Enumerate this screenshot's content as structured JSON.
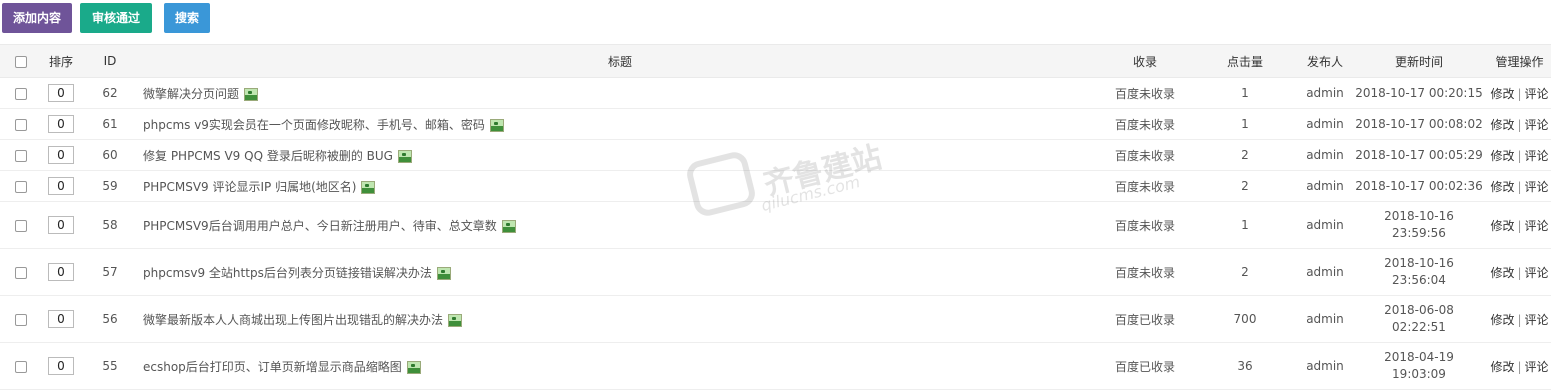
{
  "toolbar": {
    "add_label": "添加内容",
    "audit_label": "审核通过",
    "search_label": "搜索"
  },
  "table": {
    "headers": {
      "sort": "排序",
      "id": "ID",
      "title": "标题",
      "index_status": "收录",
      "hits": "点击量",
      "publisher": "发布人",
      "updated": "更新时间",
      "actions": "管理操作"
    },
    "action_edit": "修改",
    "action_sep": "|",
    "action_comment": "评论",
    "rows": [
      {
        "sort": "0",
        "id": "62",
        "title": "微擎解决分页问题",
        "status": "百度未收录",
        "hits": "1",
        "publisher": "admin",
        "time1": "2018-10-17 00:20:15",
        "time2": ""
      },
      {
        "sort": "0",
        "id": "61",
        "title": "phpcms v9实现会员在一个页面修改昵称、手机号、邮箱、密码",
        "status": "百度未收录",
        "hits": "1",
        "publisher": "admin",
        "time1": "2018-10-17 00:08:02",
        "time2": ""
      },
      {
        "sort": "0",
        "id": "60",
        "title": "修复 PHPCMS V9 QQ 登录后昵称被删的 BUG",
        "status": "百度未收录",
        "hits": "2",
        "publisher": "admin",
        "time1": "2018-10-17 00:05:29",
        "time2": ""
      },
      {
        "sort": "0",
        "id": "59",
        "title": "PHPCMSV9 评论显示IP 归属地(地区名)",
        "status": "百度未收录",
        "hits": "2",
        "publisher": "admin",
        "time1": "2018-10-17 00:02:36",
        "time2": ""
      },
      {
        "sort": "0",
        "id": "58",
        "title": "PHPCMSV9后台调用用户总户、今日新注册用户、待审、总文章数",
        "status": "百度未收录",
        "hits": "1",
        "publisher": "admin",
        "time1": "2018-10-16",
        "time2": "23:59:56"
      },
      {
        "sort": "0",
        "id": "57",
        "title": "phpcmsv9 全站https后台列表分页链接错误解决办法",
        "status": "百度未收录",
        "hits": "2",
        "publisher": "admin",
        "time1": "2018-10-16",
        "time2": "23:56:04"
      },
      {
        "sort": "0",
        "id": "56",
        "title": "微擎最新版本人人商城出现上传图片出现错乱的解决办法",
        "status": "百度已收录",
        "hits": "700",
        "publisher": "admin",
        "time1": "2018-06-08",
        "time2": "02:22:51"
      },
      {
        "sort": "0",
        "id": "55",
        "title": "ecshop后台打印页、订单页新增显示商品缩略图",
        "status": "百度已收录",
        "hits": "36",
        "publisher": "admin",
        "time1": "2018-04-19",
        "time2": "19:03:09"
      }
    ]
  },
  "watermark": {
    "text": "齐鲁建站",
    "sub": "qilucms.com"
  }
}
